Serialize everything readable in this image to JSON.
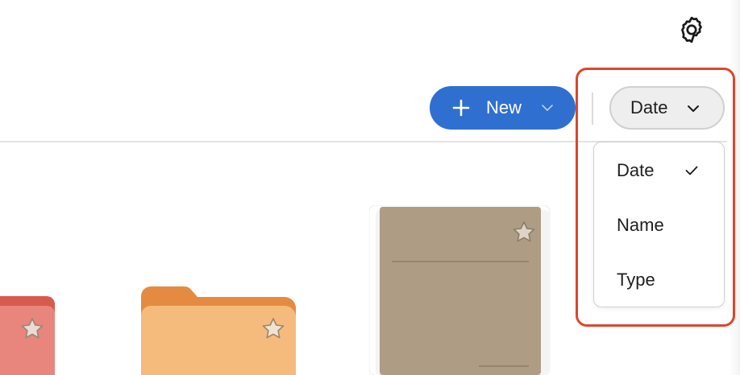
{
  "header": {
    "settings_icon": "gear-icon"
  },
  "toolbar": {
    "new_label": "New",
    "new_icon": "plus-icon",
    "new_chevron_icon": "chevron-down-icon",
    "sort_label": "Date",
    "sort_chevron_icon": "chevron-down-icon"
  },
  "sort_menu": {
    "items": [
      {
        "label": "Date",
        "selected": true
      },
      {
        "label": "Name",
        "selected": false
      },
      {
        "label": "Type",
        "selected": false
      }
    ],
    "check_icon": "checkmark-icon"
  },
  "colors": {
    "primary": "#2f6fd0",
    "highlight": "#e0452b",
    "folder_red": "#e8857d",
    "folder_orange": "#f5bb7c",
    "notebook": "#ae9d84"
  },
  "tiles": [
    {
      "kind": "folder",
      "color": "red",
      "starred": false
    },
    {
      "kind": "folder",
      "color": "orange",
      "starred": false
    },
    {
      "kind": "notebook",
      "color": "tan",
      "starred": false
    }
  ]
}
